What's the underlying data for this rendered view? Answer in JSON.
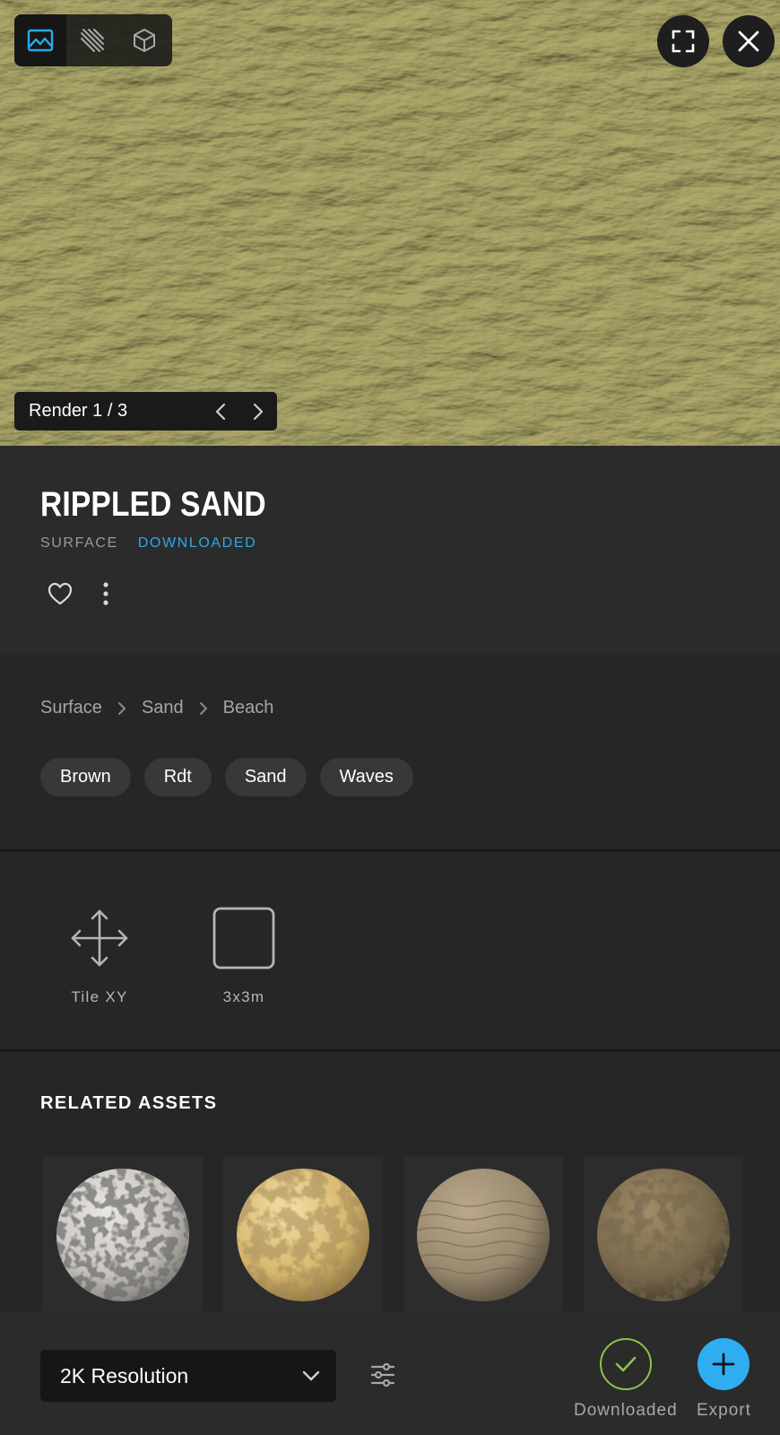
{
  "preview": {
    "views": [
      {
        "icon": "image-icon",
        "active": true
      },
      {
        "icon": "texture-lines-icon",
        "active": false
      },
      {
        "icon": "cube-icon",
        "active": false
      }
    ],
    "fullscreen_icon": "fullscreen-icon",
    "close_icon": "close-icon",
    "render_label": "Render 1 / 3"
  },
  "asset": {
    "title": "RIPPLED SAND",
    "type": "SURFACE",
    "status": "DOWNLOADED"
  },
  "breadcrumb": [
    "Surface",
    "Sand",
    "Beach"
  ],
  "tags": [
    "Brown",
    "Rdt",
    "Sand",
    "Waves"
  ],
  "properties": {
    "tile": "Tile XY",
    "size": "3x3m"
  },
  "related": {
    "heading": "RELATED ASSETS"
  },
  "bottom_bar": {
    "resolution": "2K Resolution",
    "downloaded_label": "Downloaded",
    "export_label": "Export"
  },
  "colors": {
    "accent": "#2EA8E5",
    "downloaded_ring": "#8BC34A",
    "export_button": "#2EAEF0",
    "panel": "#2B2B2B",
    "background": "#262626"
  }
}
